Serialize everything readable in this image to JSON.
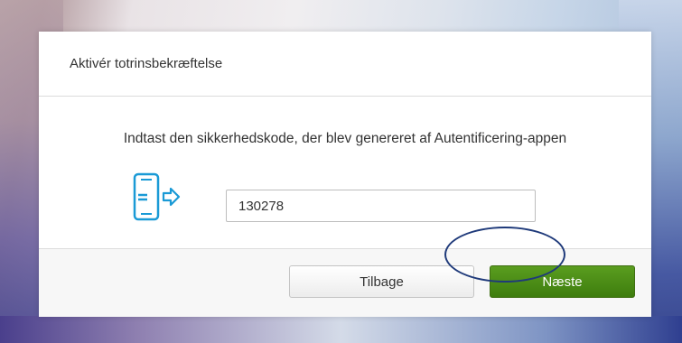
{
  "dialog": {
    "title": "Aktivér totrinsbekræftelse",
    "instruction": "Indtast den sikkerhedskode, der blev genereret af Autentificering-appen",
    "code_input": {
      "value": "130278",
      "placeholder": ""
    },
    "icons": {
      "phone": "phone-arrow-icon"
    },
    "buttons": {
      "back_label": "Tilbage",
      "next_label": "Næste"
    }
  },
  "colors": {
    "accent_blue": "#1a9ad6",
    "next_green": "#4a8c16",
    "annotation_circle": "#1f3a7a"
  }
}
